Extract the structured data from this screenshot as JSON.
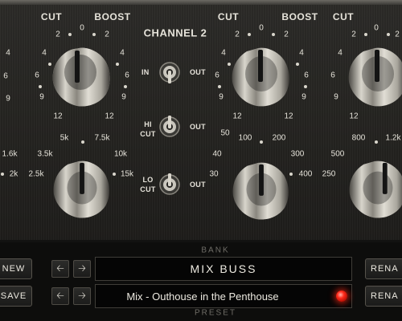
{
  "header": {
    "channel_title": "CHANNEL 2",
    "cut": "CUT",
    "boost": "BOOST"
  },
  "gain_scale": [
    "2",
    "0",
    "2",
    "4",
    "4",
    "6",
    "6",
    "9",
    "9",
    "12",
    "12"
  ],
  "switches": {
    "in_label": "IN",
    "out_label": "OUT",
    "hicut_line1": "HI",
    "hicut_line2": "CUT",
    "hicut_out": "OUT",
    "locut_line1": "LO",
    "locut_line2": "CUT",
    "locut_out": "OUT"
  },
  "ch1_freq_ticks": [
    "1.6k",
    "2k",
    "2.5k",
    "3.5k",
    "5k",
    "7.5k",
    "10k",
    "15k"
  ],
  "ch2_freq_ticks": [
    "30",
    "40",
    "50",
    "100",
    "200",
    "300",
    "400"
  ],
  "ch3_freq_ticks": [
    "250",
    "500",
    "800",
    "1.2k"
  ],
  "ch3_partial": {
    "boost_4": "4",
    "left_6": "6",
    "left_9": "9",
    "left_12": "12"
  },
  "ch0_partial": {
    "t4": "4",
    "t6": "6",
    "t9": "9"
  },
  "bank": {
    "caption": "BANK",
    "value": "MIX BUSS",
    "new_label": "NEW",
    "rename_label": "RENA"
  },
  "preset": {
    "caption": "PRESET",
    "value": "Mix - Outhouse in the Penthouse",
    "save_label": "SAVE",
    "rename_label": "RENA"
  },
  "icons": {
    "prev": "left-arrow-icon",
    "next": "right-arrow-icon"
  },
  "colors": {
    "faceplate": "#262522",
    "label": "#e6e3da",
    "display_bg": "#050505",
    "led": "#ff2a1a"
  }
}
